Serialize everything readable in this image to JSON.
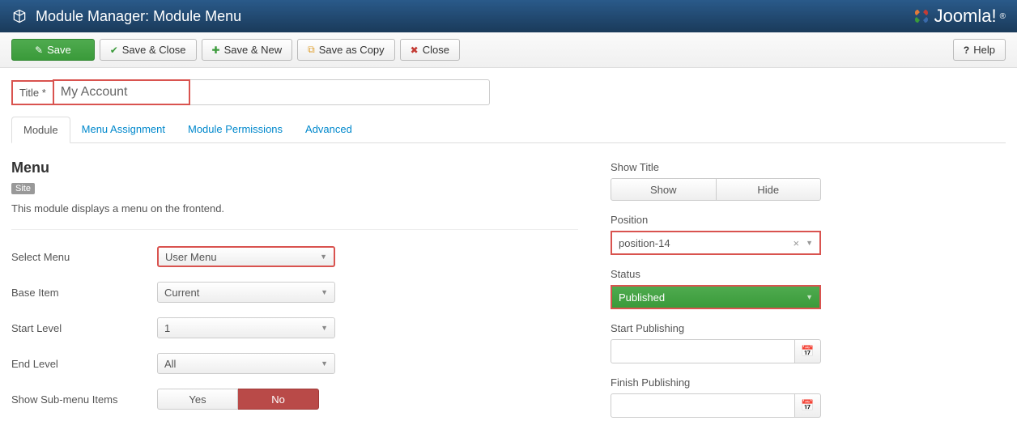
{
  "header": {
    "title": "Module Manager: Module Menu",
    "brand": "Joomla!"
  },
  "toolbar": {
    "save": "Save",
    "save_close": "Save & Close",
    "save_new": "Save & New",
    "save_copy": "Save as Copy",
    "close": "Close",
    "help": "Help"
  },
  "title_field": {
    "label": "Title *",
    "value": "My Account"
  },
  "tabs": {
    "module": "Module",
    "menu_assignment": "Menu Assignment",
    "module_permissions": "Module Permissions",
    "advanced": "Advanced"
  },
  "module_section": {
    "heading": "Menu",
    "badge": "Site",
    "description": "This module displays a menu on the frontend."
  },
  "fields": {
    "select_menu": {
      "label": "Select Menu",
      "value": "User Menu"
    },
    "base_item": {
      "label": "Base Item",
      "value": "Current"
    },
    "start_level": {
      "label": "Start Level",
      "value": "1"
    },
    "end_level": {
      "label": "End Level",
      "value": "All"
    },
    "show_submenu": {
      "label": "Show Sub-menu Items",
      "yes": "Yes",
      "no": "No"
    }
  },
  "sidebar": {
    "show_title": {
      "label": "Show Title",
      "show": "Show",
      "hide": "Hide"
    },
    "position": {
      "label": "Position",
      "value": "position-14"
    },
    "status": {
      "label": "Status",
      "value": "Published"
    },
    "start_publishing": {
      "label": "Start Publishing"
    },
    "finish_publishing": {
      "label": "Finish Publishing"
    }
  }
}
